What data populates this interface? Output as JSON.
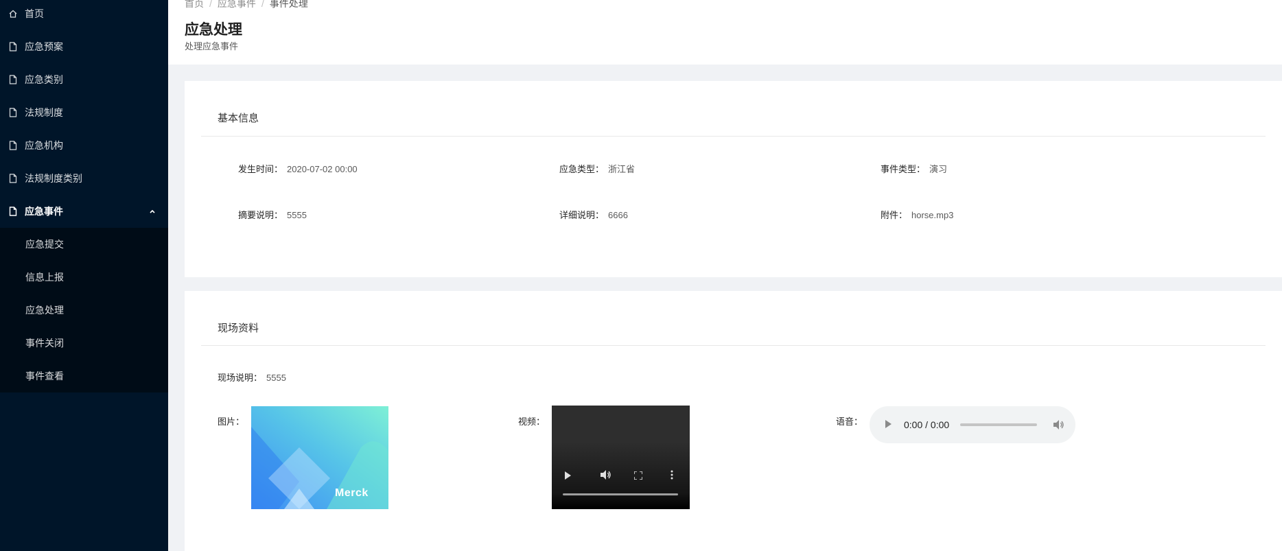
{
  "sidebar": {
    "items": [
      {
        "label": "首页",
        "icon": "home-icon"
      },
      {
        "label": "应急预案",
        "icon": "file-icon"
      },
      {
        "label": "应急类别",
        "icon": "file-icon"
      },
      {
        "label": "法规制度",
        "icon": "file-icon"
      },
      {
        "label": "应急机构",
        "icon": "file-icon"
      },
      {
        "label": "法规制度类别",
        "icon": "file-icon"
      },
      {
        "label": "应急事件",
        "icon": "file-icon",
        "expanded": true
      }
    ],
    "submenu": [
      {
        "label": "应急提交"
      },
      {
        "label": "信息上报"
      },
      {
        "label": "应急处理"
      },
      {
        "label": "事件关闭"
      },
      {
        "label": "事件查看"
      }
    ]
  },
  "breadcrumb": [
    "首页",
    "应急事件",
    "事件处理"
  ],
  "header": {
    "title": "应急处理",
    "subtitle": "处理应急事件"
  },
  "basic_info": {
    "title": "基本信息",
    "fields": [
      {
        "label": "发生时间：",
        "value": "2020-07-02 00:00"
      },
      {
        "label": "应急类型：",
        "value": "浙江省"
      },
      {
        "label": "事件类型：",
        "value": "演习"
      },
      {
        "label": "摘要说明：",
        "value": "5555"
      },
      {
        "label": "详细说明：",
        "value": "6666"
      },
      {
        "label": "附件：",
        "value": "horse.mp3"
      }
    ]
  },
  "scene": {
    "title": "现场资料",
    "description_label": "现场说明：",
    "description_value": "5555",
    "image_label": "图片：",
    "image_logo_text": "Merck",
    "video_label": "视频：",
    "audio_label": "语音：",
    "audio_time": "0:00 / 0:00"
  },
  "colors": {
    "sidebar_bg": "#001529",
    "submenu_bg": "#000c17",
    "page_bg": "#f0f2f5"
  }
}
